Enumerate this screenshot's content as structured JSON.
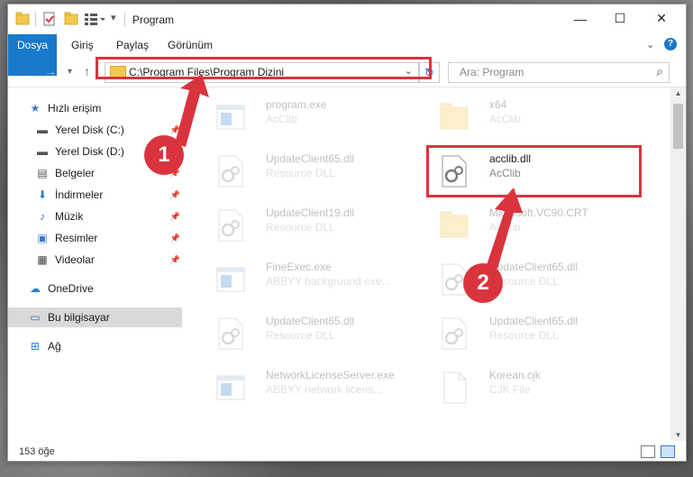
{
  "window": {
    "title": "Program",
    "quick_access": [
      "folder-icon",
      "properties-icon",
      "new-folder-icon",
      "customize-icon"
    ],
    "controls": {
      "minimize": "—",
      "maximize": "☐",
      "close": "✕"
    }
  },
  "ribbon": {
    "tabs": [
      "Dosya",
      "Giriş",
      "Paylaş",
      "Görünüm"
    ],
    "expand_chevron": "⌄",
    "help": "?"
  },
  "nav": {
    "address": "C:\\Program Files\\Program Dizini",
    "search_placeholder": "Ara: Program"
  },
  "sidebar": {
    "items": [
      {
        "label": "Hızlı erişim",
        "icon": "star-icon",
        "pinned": false
      },
      {
        "label": "Yerel Disk (C:)",
        "icon": "drive-icon",
        "pinned": true
      },
      {
        "label": "Yerel Disk (D:)",
        "icon": "drive-icon",
        "pinned": true
      },
      {
        "label": "Belgeler",
        "icon": "documents-icon",
        "pinned": true
      },
      {
        "label": "İndirmeler",
        "icon": "downloads-icon",
        "pinned": true
      },
      {
        "label": "Müzik",
        "icon": "music-icon",
        "pinned": true
      },
      {
        "label": "Resimler",
        "icon": "pictures-icon",
        "pinned": true
      },
      {
        "label": "Videolar",
        "icon": "videos-icon",
        "pinned": true
      },
      {
        "label": "OneDrive",
        "icon": "cloud-icon",
        "pinned": false
      },
      {
        "label": "Bu bilgisayar",
        "icon": "computer-icon",
        "pinned": false
      },
      {
        "label": "Ağ",
        "icon": "network-icon",
        "pinned": false
      }
    ]
  },
  "files": [
    {
      "name": "program.exe",
      "sub": "AcClib",
      "icon": "exe-icon"
    },
    {
      "name": "x64",
      "sub": "AcClib",
      "icon": "folder-icon"
    },
    {
      "name": "UpdateClient65.dll",
      "sub": "Resource DLL",
      "icon": "dll-icon"
    },
    {
      "name": "acclib.dll",
      "sub": "AcClib",
      "icon": "dll-icon"
    },
    {
      "name": "UpdateClient19.dll",
      "sub": "Resource DLL",
      "icon": "dll-icon"
    },
    {
      "name": "Microsoft.VC90.CRT",
      "sub": "AcClib",
      "icon": "folder-icon"
    },
    {
      "name": "FineExec.exe",
      "sub": "ABBYY background exe...",
      "icon": "exe-icon"
    },
    {
      "name": "UpdateClient65.dll",
      "sub": "Resource DLL",
      "icon": "dll-icon"
    },
    {
      "name": "UpdateClient65.dll",
      "sub": "Resource DLL",
      "icon": "dll-icon"
    },
    {
      "name": "UpdateClient65.dll",
      "sub": "Resource DLL",
      "icon": "dll-icon"
    },
    {
      "name": "NetworkLicenseServer.exe",
      "sub": "ABBYY network licens...",
      "icon": "exe-icon"
    },
    {
      "name": "Korean.cjk",
      "sub": "CJK File",
      "icon": "file-icon"
    }
  ],
  "status": {
    "count": "153 öğe"
  },
  "callouts": [
    "1",
    "2"
  ],
  "colors": {
    "accent": "#1979ca",
    "highlight": "#d9343d"
  }
}
